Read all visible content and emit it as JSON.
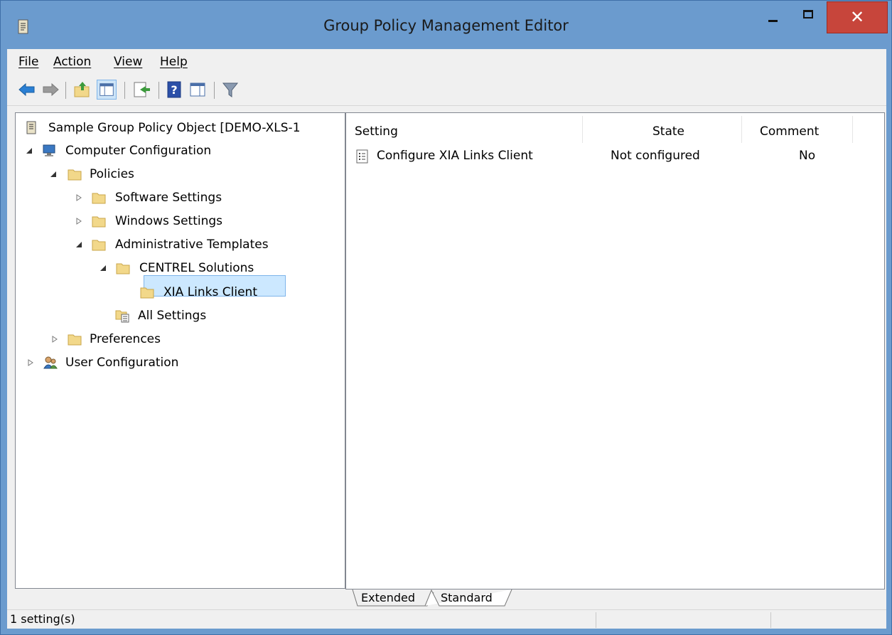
{
  "window": {
    "title": "Group Policy Management Editor",
    "close_glyph": "✕"
  },
  "menu": {
    "file": "File",
    "action": "Action",
    "view": "View",
    "help": "Help"
  },
  "toolbar": {
    "icons": [
      "back-arrow-icon",
      "forward-arrow-icon",
      "up-folder-icon",
      "show-hide-tree-icon",
      "export-list-icon",
      "help-icon",
      "show-hide-action-pane-icon",
      "filter-icon"
    ]
  },
  "tree": {
    "root": "Sample Group Policy Object [DEMO-XLS-1",
    "computer_config": "Computer Configuration",
    "policies": "Policies",
    "software_settings": "Software Settings",
    "windows_settings": "Windows Settings",
    "admin_templates": "Administrative Templates",
    "centrel": "CENTREL Solutions",
    "xia_links": "XIA Links Client",
    "all_settings": "All Settings",
    "preferences": "Preferences",
    "user_config": "User Configuration"
  },
  "details": {
    "columns": {
      "setting": "Setting",
      "state": "State",
      "comment": "Comment"
    },
    "rows": [
      {
        "setting": "Configure XIA Links Client",
        "state": "Not configured",
        "comment": "No"
      }
    ]
  },
  "tabs": {
    "extended": "Extended",
    "standard": "Standard",
    "active": "Standard"
  },
  "status": {
    "text": "1 setting(s)"
  },
  "colors": {
    "title_bar": "#6b9bce",
    "close_button": "#c7453b",
    "selection": "#cce8ff",
    "folder": "#f2d88a"
  }
}
